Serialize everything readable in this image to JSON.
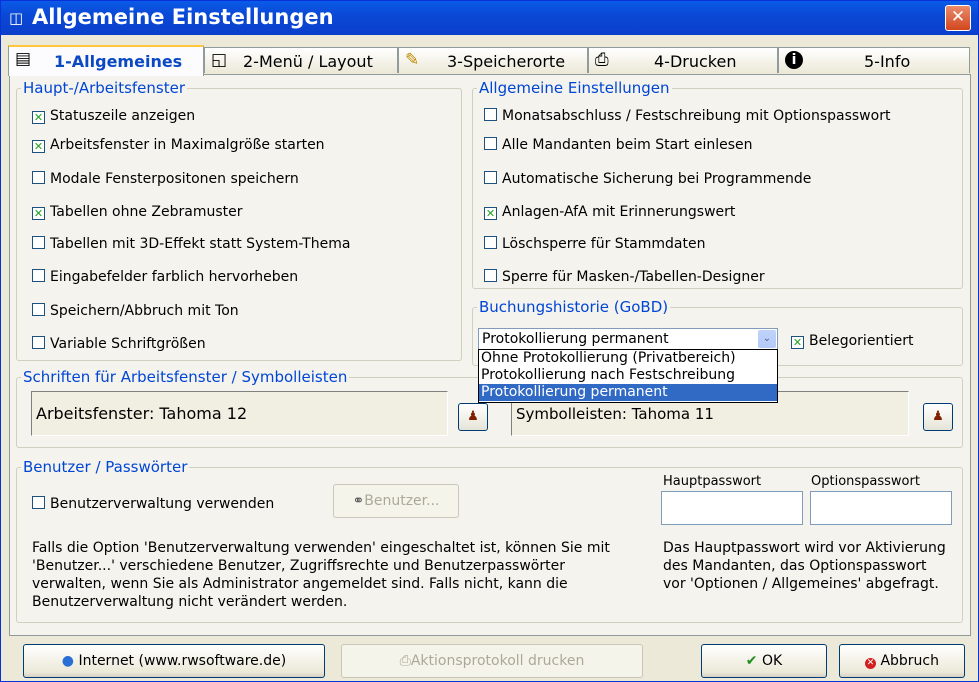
{
  "window": {
    "title": "Allgemeine Einstellungen",
    "close": "✕"
  },
  "tabs": [
    {
      "label": "1-Allgemeines",
      "icon": "settings-form-icon"
    },
    {
      "label": "2-Menü / Layout",
      "icon": "layout-icon"
    },
    {
      "label": "3-Speicherorte",
      "icon": "notepad-pencil-icon"
    },
    {
      "label": "4-Drucken",
      "icon": "printer-icon"
    },
    {
      "label": "5-Info",
      "icon": "info-icon"
    }
  ],
  "main_window": {
    "legend": "Haupt-/Arbeitsfenster",
    "options": [
      {
        "label": "Statuszeile anzeigen",
        "checked": true
      },
      {
        "label": "Arbeitsfenster in Maximalgröße starten",
        "checked": true
      },
      {
        "label": "Modale Fensterpositonen speichern",
        "checked": false
      },
      {
        "label": "Tabellen ohne Zebramuster",
        "checked": true
      },
      {
        "label": "Tabellen mit 3D-Effekt statt System-Thema",
        "checked": false
      },
      {
        "label": "Eingabefelder farblich hervorheben",
        "checked": false
      },
      {
        "label": "Speichern/Abbruch mit Ton",
        "checked": false
      },
      {
        "label": "Variable Schriftgrößen",
        "checked": false
      }
    ]
  },
  "general": {
    "legend": "Allgemeine Einstellungen",
    "options": [
      {
        "label": "Monatsabschluss / Festschreibung mit Optionspasswort",
        "checked": false
      },
      {
        "label": "Alle Mandanten beim Start einlesen",
        "checked": false
      },
      {
        "label": "Automatische Sicherung bei Programmende",
        "checked": false
      },
      {
        "label": "Anlagen-AfA mit Erinnerungswert",
        "checked": true
      },
      {
        "label": "Löschsperre für Stammdaten",
        "checked": false
      },
      {
        "label": "Sperre für Masken-/Tabellen-Designer",
        "checked": false
      }
    ]
  },
  "history": {
    "legend": "Buchungshistorie (GoBD)",
    "selected": "Protokollierung permanent",
    "options": [
      "Ohne Protokollierung (Privatbereich)",
      "Protokollierung nach Festschreibung",
      "Protokollierung permanent"
    ],
    "belegorientiert": {
      "label": "Belegorientiert",
      "checked": true
    }
  },
  "fonts": {
    "legend": "Schriften für Arbeitsfenster / Symbolleisten",
    "work": "Arbeitsfenster: Tahoma 12",
    "toolbar": "Symbolleisten: Tahoma 11"
  },
  "users": {
    "legend": "Benutzer / Passwörter",
    "use_label": "Benutzerverwaltung verwenden",
    "use_checked": false,
    "button": "Benutzer...",
    "main_pw_label": "Hauptpasswort",
    "option_pw_label": "Optionspasswort",
    "main_pw": "",
    "option_pw": "",
    "info_left": "Falls die Option 'Benutzerverwaltung verwenden' eingeschaltet ist, können Sie mit 'Benutzer...' verschiedene Benutzer, Zugriffsrechte und Benutzerpasswörter verwalten, wenn Sie als Administrator angemeldet sind. Falls nicht, kann die Benutzerverwaltung nicht verändert werden.",
    "info_right": "Das Hauptpasswort wird vor Aktivierung des Mandanten, das Optionspasswort vor 'Optionen / Allgemeines' abgefragt."
  },
  "footer": {
    "internet": "Internet (www.rwsoftware.de)",
    "print_log": "Aktionsprotokoll drucken",
    "ok": "OK",
    "cancel": "Abbruch"
  },
  "colors": {
    "accent": "#0046d5",
    "check": "#21a121",
    "selection": "#316ac5"
  }
}
